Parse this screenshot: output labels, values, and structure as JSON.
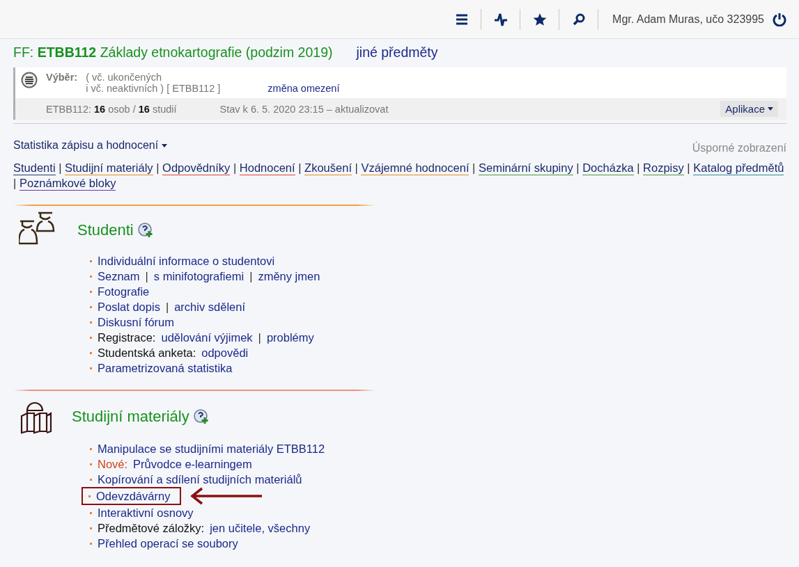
{
  "topbar": {
    "user": "Mgr. Adam Muras, učo 323995"
  },
  "course": {
    "title": "FF: **ETBB112** Základy etnokartografie (podzim 2019)",
    "other_link": "jiné předměty"
  },
  "filter": {
    "label": "Výběr:",
    "line1": "( vč. ukončených",
    "line2": "i vč. neaktivních ) [ ETBB112 ]",
    "change_link": "změna omezení",
    "stats": "ETBB112: **16** osob / **16** studií",
    "state": "Stav k 6. 5. 2020 23:15 – aktualizovat",
    "app_button": "Aplikace"
  },
  "stats_menu": "Statistika zápisu a hodnocení",
  "compact_view": "Úsporné zobrazení",
  "nav_links": [
    {
      "kind": "link",
      "label": "Studenti",
      "color": "#1a3a7a"
    },
    {
      "kind": "sep",
      "label": "|"
    },
    {
      "kind": "link",
      "label": "Studijní materiály",
      "color": "#e8891e"
    },
    {
      "kind": "sep",
      "label": "|"
    },
    {
      "kind": "link",
      "label": "Odpovědníky",
      "color": "#d9452b"
    },
    {
      "kind": "sep",
      "label": "|"
    },
    {
      "kind": "link",
      "label": "Hodnocení",
      "color": "#d9452b"
    },
    {
      "kind": "sep",
      "label": "|"
    },
    {
      "kind": "link",
      "label": "Zkoušení",
      "color": "#e8891e"
    },
    {
      "kind": "sep",
      "label": "|"
    },
    {
      "kind": "link",
      "label": "Vzájemné hodnocení",
      "color": "#e8891e"
    },
    {
      "kind": "sep",
      "label": "|"
    },
    {
      "kind": "link",
      "label": "Seminární skupiny",
      "color": "#4a9a3a"
    },
    {
      "kind": "sep",
      "label": "|"
    },
    {
      "kind": "link",
      "label": "Docházka",
      "color": "#4a9a3a"
    },
    {
      "kind": "sep",
      "label": "|"
    },
    {
      "kind": "link",
      "label": "Rozpisy",
      "color": "#4a9a3a"
    },
    {
      "kind": "sep",
      "label": "|"
    },
    {
      "kind": "link",
      "label": "Katalog předmětů",
      "color": "#2a8a9a"
    },
    {
      "kind": "sep",
      "label": "|"
    },
    {
      "kind": "link",
      "label": "Poznámkové bloky",
      "color": "#6a3aa0"
    }
  ],
  "sections": [
    {
      "kind": "students",
      "title": "Studenti",
      "items": [
        {
          "annotated": false,
          "parts": [
            {
              "kind": "link",
              "text": "Individuální informace o studentovi"
            }
          ]
        },
        {
          "annotated": false,
          "parts": [
            {
              "kind": "link",
              "text": "Seznam"
            },
            {
              "kind": "sep",
              "text": "|"
            },
            {
              "kind": "link",
              "text": "s minifotografiemi"
            },
            {
              "kind": "sep",
              "text": "|"
            },
            {
              "kind": "link",
              "text": "změny jmen"
            }
          ]
        },
        {
          "annotated": false,
          "parts": [
            {
              "kind": "link",
              "text": "Fotografie"
            }
          ]
        },
        {
          "annotated": false,
          "parts": [
            {
              "kind": "link",
              "text": "Poslat dopis"
            },
            {
              "kind": "sep",
              "text": "|"
            },
            {
              "kind": "link",
              "text": "archiv sdělení"
            }
          ]
        },
        {
          "annotated": false,
          "parts": [
            {
              "kind": "link",
              "text": "Diskusní fórum"
            }
          ]
        },
        {
          "annotated": false,
          "parts": [
            {
              "kind": "label",
              "text": "Registrace:"
            },
            {
              "kind": "link",
              "text": "udělování výjimek"
            },
            {
              "kind": "sep",
              "text": "|"
            },
            {
              "kind": "link",
              "text": "problémy"
            }
          ]
        },
        {
          "annotated": false,
          "parts": [
            {
              "kind": "label",
              "text": "Studentská anketa:"
            },
            {
              "kind": "link",
              "text": "odpovědi"
            }
          ]
        },
        {
          "annotated": false,
          "parts": [
            {
              "kind": "link",
              "text": "Parametrizovaná statistika"
            }
          ]
        }
      ]
    },
    {
      "kind": "materials",
      "title": "Studijní materiály",
      "items": [
        {
          "annotated": false,
          "parts": [
            {
              "kind": "link",
              "text": "Manipulace se studijními materiály ETBB112"
            }
          ]
        },
        {
          "annotated": false,
          "parts": [
            {
              "kind": "new",
              "text": "Nové:"
            },
            {
              "kind": "link",
              "text": "Průvodce e-learningem"
            }
          ]
        },
        {
          "annotated": false,
          "parts": [
            {
              "kind": "link",
              "text": "Kopírování a sdílení studijních materiálů"
            }
          ]
        },
        {
          "annotated": true,
          "parts": [
            {
              "kind": "link",
              "text": "Odevzdávárny"
            }
          ]
        },
        {
          "annotated": false,
          "parts": [
            {
              "kind": "link",
              "text": "Interaktivní osnovy"
            }
          ]
        },
        {
          "annotated": false,
          "parts": [
            {
              "kind": "label",
              "text": "Předmětové záložky:"
            },
            {
              "kind": "link",
              "text": "jen učitele, všechny"
            }
          ]
        },
        {
          "annotated": false,
          "parts": [
            {
              "kind": "link",
              "text": "Přehled operací se soubory"
            }
          ]
        }
      ]
    }
  ]
}
